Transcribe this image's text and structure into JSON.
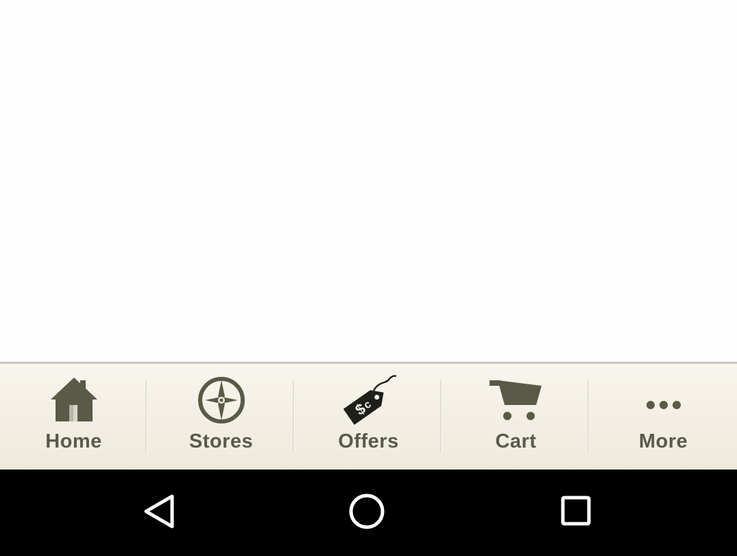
{
  "tab_bar": {
    "colors": {
      "icon": "#5a5a46",
      "label": "#5a5a4a",
      "background_top": "#f8f5ee",
      "background_bottom": "#efe9dc"
    },
    "tabs": [
      {
        "label": "Home",
        "icon": "home-icon"
      },
      {
        "label": "Stores",
        "icon": "compass-icon"
      },
      {
        "label": "Offers",
        "icon": "price-tag-icon"
      },
      {
        "label": "Cart",
        "icon": "cart-icon"
      },
      {
        "label": "More",
        "icon": "more-dots-icon"
      }
    ]
  },
  "system_nav": {
    "background": "#000000",
    "buttons": [
      {
        "name": "back",
        "icon": "back-triangle-icon"
      },
      {
        "name": "home",
        "icon": "home-circle-icon"
      },
      {
        "name": "recents",
        "icon": "recents-square-icon"
      }
    ]
  }
}
